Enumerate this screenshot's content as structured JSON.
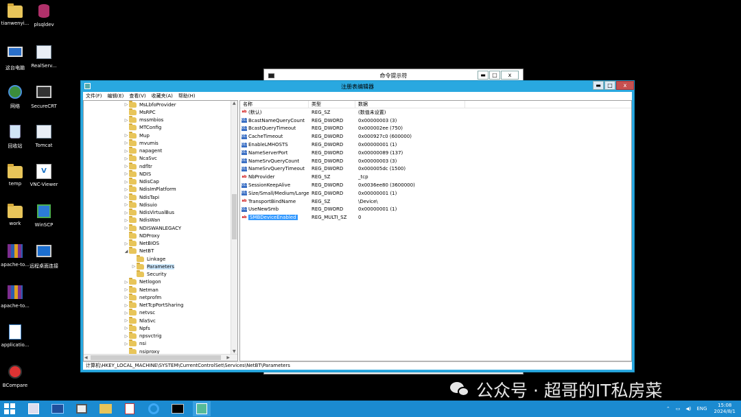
{
  "desktop": {
    "icons": [
      {
        "label": "tianwenyi...",
        "icon": "folder-icon"
      },
      {
        "label": "plsqldev",
        "icon": "database-icon"
      },
      {
        "label": "这台电脑",
        "icon": "computer-icon"
      },
      {
        "label": "RealServ...",
        "icon": "app-icon"
      },
      {
        "label": "网络",
        "icon": "network-icon"
      },
      {
        "label": "SecureCRT",
        "icon": "terminal-icon"
      },
      {
        "label": "回收站",
        "icon": "recycle-bin-icon"
      },
      {
        "label": "Tomcat",
        "icon": "app-icon"
      },
      {
        "label": "temp",
        "icon": "folder-icon"
      },
      {
        "label": "VNC-Viewer",
        "icon": "vnc-icon"
      },
      {
        "label": "work",
        "icon": "folder-icon"
      },
      {
        "label": "WinSCP",
        "icon": "winscp-icon"
      },
      {
        "label": "apache-to...",
        "icon": "archive-icon"
      },
      {
        "label": "远程桌面连接",
        "icon": "remote-desktop-icon"
      },
      {
        "label": "apache-to...",
        "icon": "archive-icon"
      },
      {
        "label": "applicatio...",
        "icon": "document-icon"
      },
      {
        "label": "BCompare",
        "icon": "bcompare-icon"
      }
    ]
  },
  "cmd_window": {
    "title": "命令提示符",
    "buttons": {
      "minimize": "▬",
      "maximize": "□",
      "close": "x"
    }
  },
  "regedit": {
    "title": "注册表编辑器",
    "buttons": {
      "minimize": "▬",
      "maximize": "□",
      "close": "x"
    },
    "menu": [
      "文件(F)",
      "编辑(E)",
      "查看(V)",
      "收藏夹(A)",
      "帮助(H)"
    ],
    "tree": [
      {
        "label": "MsLbfoProvider",
        "arrow": "▷",
        "indent": 0
      },
      {
        "label": "MsRPC",
        "arrow": "",
        "indent": 0
      },
      {
        "label": "mssmbios",
        "arrow": "▷",
        "indent": 0
      },
      {
        "label": "MTConfig",
        "arrow": "",
        "indent": 0
      },
      {
        "label": "Mup",
        "arrow": "▷",
        "indent": 0
      },
      {
        "label": "mvumis",
        "arrow": "▷",
        "indent": 0
      },
      {
        "label": "napagent",
        "arrow": "▷",
        "indent": 0
      },
      {
        "label": "NcaSvc",
        "arrow": "▷",
        "indent": 0
      },
      {
        "label": "ndfltr",
        "arrow": "▷",
        "indent": 0
      },
      {
        "label": "NDIS",
        "arrow": "▷",
        "indent": 0
      },
      {
        "label": "NdisCap",
        "arrow": "▷",
        "indent": 0
      },
      {
        "label": "NdisImPlatform",
        "arrow": "▷",
        "indent": 0
      },
      {
        "label": "NdisTapi",
        "arrow": "▷",
        "indent": 0
      },
      {
        "label": "Ndisuio",
        "arrow": "▷",
        "indent": 0
      },
      {
        "label": "NdisVirtualBus",
        "arrow": "▷",
        "indent": 0
      },
      {
        "label": "NdisWan",
        "arrow": "▷",
        "indent": 0
      },
      {
        "label": "NDISWANLEGACY",
        "arrow": "▷",
        "indent": 0
      },
      {
        "label": "NDProxy",
        "arrow": "",
        "indent": 0
      },
      {
        "label": "NetBIOS",
        "arrow": "▷",
        "indent": 0
      },
      {
        "label": "NetBT",
        "arrow": "◢",
        "indent": 0
      },
      {
        "label": "Linkage",
        "arrow": "",
        "indent": 1
      },
      {
        "label": "Parameters",
        "arrow": "▷",
        "indent": 1,
        "selected": true
      },
      {
        "label": "Security",
        "arrow": "",
        "indent": 1
      },
      {
        "label": "Netlogon",
        "arrow": "▷",
        "indent": 0
      },
      {
        "label": "Netman",
        "arrow": "▷",
        "indent": 0
      },
      {
        "label": "netprofm",
        "arrow": "▷",
        "indent": 0
      },
      {
        "label": "NetTcpPortSharing",
        "arrow": "▷",
        "indent": 0
      },
      {
        "label": "netvsc",
        "arrow": "▷",
        "indent": 0
      },
      {
        "label": "NlaSvc",
        "arrow": "▷",
        "indent": 0
      },
      {
        "label": "Npfs",
        "arrow": "▷",
        "indent": 0
      },
      {
        "label": "npsvctrig",
        "arrow": "▷",
        "indent": 0
      },
      {
        "label": "nsi",
        "arrow": "▷",
        "indent": 0
      },
      {
        "label": "nsiproxy",
        "arrow": "",
        "indent": 0
      }
    ],
    "columns": {
      "name": "名称",
      "type": "类型",
      "data": "数据"
    },
    "values": [
      {
        "name": "(默认)",
        "type": "REG_SZ",
        "data": "(数值未设置)",
        "icon": "ab"
      },
      {
        "name": "BcastNameQueryCount",
        "type": "REG_DWORD",
        "data": "0x00000003 (3)",
        "icon": "bin"
      },
      {
        "name": "BcastQueryTimeout",
        "type": "REG_DWORD",
        "data": "0x000002ee (750)",
        "icon": "bin"
      },
      {
        "name": "CacheTimeout",
        "type": "REG_DWORD",
        "data": "0x000927c0 (600000)",
        "icon": "bin"
      },
      {
        "name": "EnableLMHOSTS",
        "type": "REG_DWORD",
        "data": "0x00000001 (1)",
        "icon": "bin"
      },
      {
        "name": "NameServerPort",
        "type": "REG_DWORD",
        "data": "0x00000089 (137)",
        "icon": "bin"
      },
      {
        "name": "NameSrvQueryCount",
        "type": "REG_DWORD",
        "data": "0x00000003 (3)",
        "icon": "bin"
      },
      {
        "name": "NameSrvQueryTimeout",
        "type": "REG_DWORD",
        "data": "0x000005dc (1500)",
        "icon": "bin"
      },
      {
        "name": "NbProvider",
        "type": "REG_SZ",
        "data": "_tcp",
        "icon": "ab"
      },
      {
        "name": "SessionKeepAlive",
        "type": "REG_DWORD",
        "data": "0x0036ee80 (3600000)",
        "icon": "bin"
      },
      {
        "name": "Size/Small/Medium/Large",
        "type": "REG_DWORD",
        "data": "0x00000001 (1)",
        "icon": "bin"
      },
      {
        "name": "TransportBindName",
        "type": "REG_SZ",
        "data": "\\Device\\",
        "icon": "ab"
      },
      {
        "name": "UseNewSmb",
        "type": "REG_DWORD",
        "data": "0x00000001 (1)",
        "icon": "bin"
      },
      {
        "name": "SMBDeviceEnabled",
        "type": "REG_MULTI_SZ",
        "data": "0",
        "icon": "ab",
        "selected": true
      }
    ],
    "status": "计算机\\HKEY_LOCAL_MACHINE\\SYSTEM\\CurrentControlSet\\Services\\NetBT\\Parameters"
  },
  "watermark": "公众号 · 超哥的IT私房菜",
  "taskbar": {
    "items": [
      "server-manager-icon",
      "powershell-icon",
      "explorer-window-icon",
      "file-explorer-icon",
      "java-icon",
      "ie-icon",
      "cmd-icon",
      "regedit-icon"
    ],
    "tray": {
      "lang": "ENG",
      "time": "15:08",
      "date": "2024/8/1"
    }
  },
  "colors": {
    "taskbar": "#1b8ad0",
    "window_frame": "#29a8e0",
    "selection": "#3399ff"
  }
}
